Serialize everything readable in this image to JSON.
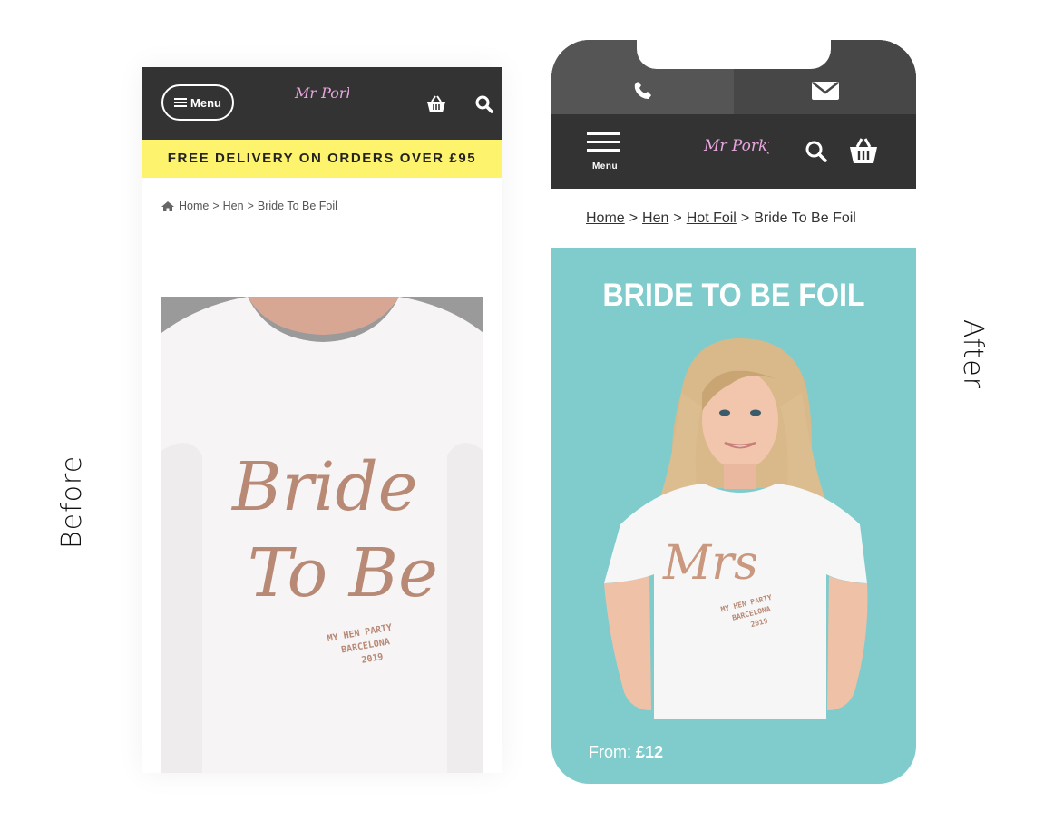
{
  "labels": {
    "before": "Before",
    "after": "After"
  },
  "before": {
    "menu_label": "Menu",
    "logo_text": "Mr Porkys",
    "banner_text": "FREE DELIVERY ON ORDERS OVER £95",
    "breadcrumb": {
      "home": "Home",
      "sep1": ">",
      "hen": "Hen",
      "sep2": ">",
      "current": "Bride To Be Foil"
    },
    "shirt_text": {
      "line1": "Bride",
      "line2": "To Be",
      "small1": "MY HEN PARTY",
      "small2": "BARCELONA",
      "small3": "2019"
    },
    "icons": [
      "menu-icon",
      "basket-icon",
      "search-icon",
      "home-icon"
    ]
  },
  "after": {
    "menu_label": "Menu",
    "logo_text": "Mr Porkys",
    "breadcrumb": {
      "home": "Home",
      "sep1": ">",
      "hen": "Hen",
      "sep2": ">",
      "hot_foil": "Hot Foil",
      "sep3": ">",
      "current": "Bride To Be Foil"
    },
    "title": "BRIDE TO BE FOIL",
    "shirt_text": {
      "main": "Mrs",
      "small1": "MY HEN PARTY",
      "small2": "BARCELONA",
      "small3": "2019"
    },
    "price_prefix": "From:",
    "price": "£12",
    "icons": [
      "phone-icon",
      "email-icon",
      "menu-icon",
      "search-icon",
      "basket-icon"
    ]
  },
  "colors": {
    "header": "#333333",
    "banner": "#fdf36d",
    "teal": "#80cccd",
    "logo_pink": "#e8a6e0"
  }
}
